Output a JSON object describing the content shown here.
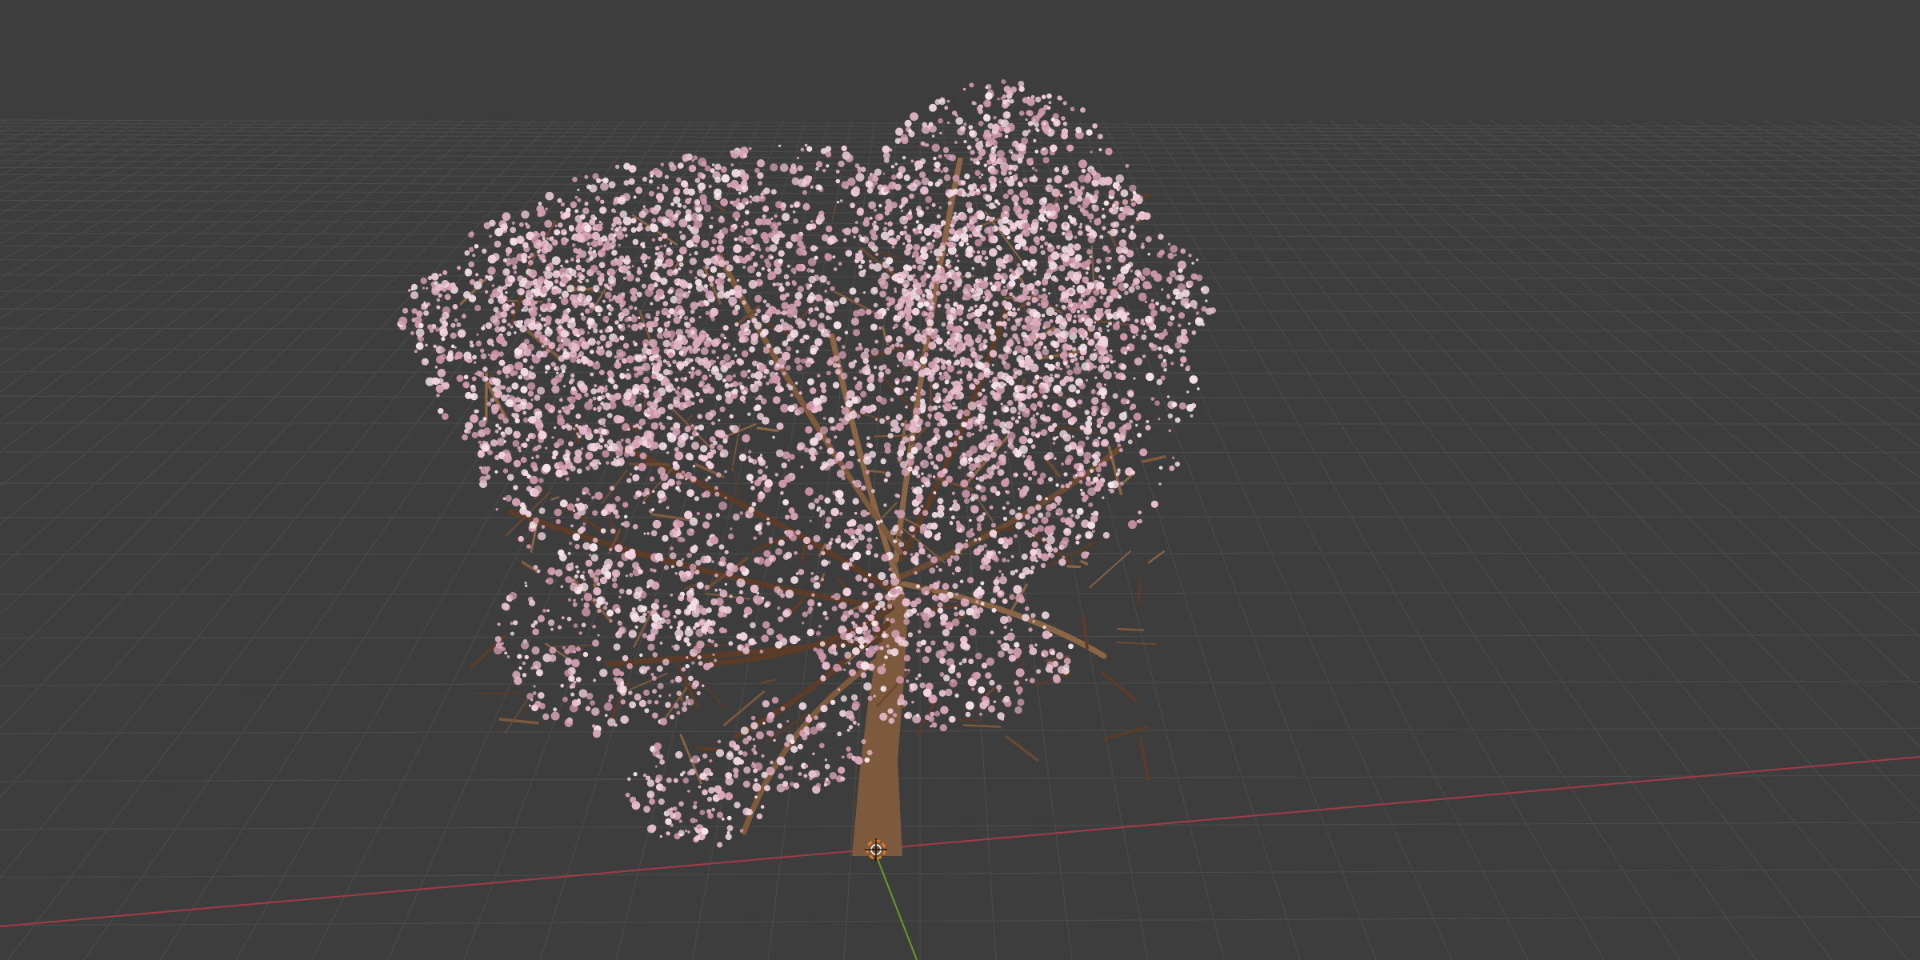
{
  "viewport": {
    "background_color": "#3d3d3d",
    "grid_color": "#4a4a4a",
    "x_axis_color": "#a43a44",
    "y_axis_color": "#6a9a2a",
    "cursor_color": "#e07a2a"
  },
  "scene": {
    "object": "cherry-blossom-tree",
    "blossom_colors": [
      "#f2d2de",
      "#e8bccc",
      "#d9a6b8",
      "#f7e3ea",
      "#cf98ab"
    ],
    "bark_colors": [
      "#6b4a33",
      "#7d5a3e",
      "#5a3c28",
      "#8a6647"
    ],
    "cursor_icon": "3d-cursor-icon"
  }
}
